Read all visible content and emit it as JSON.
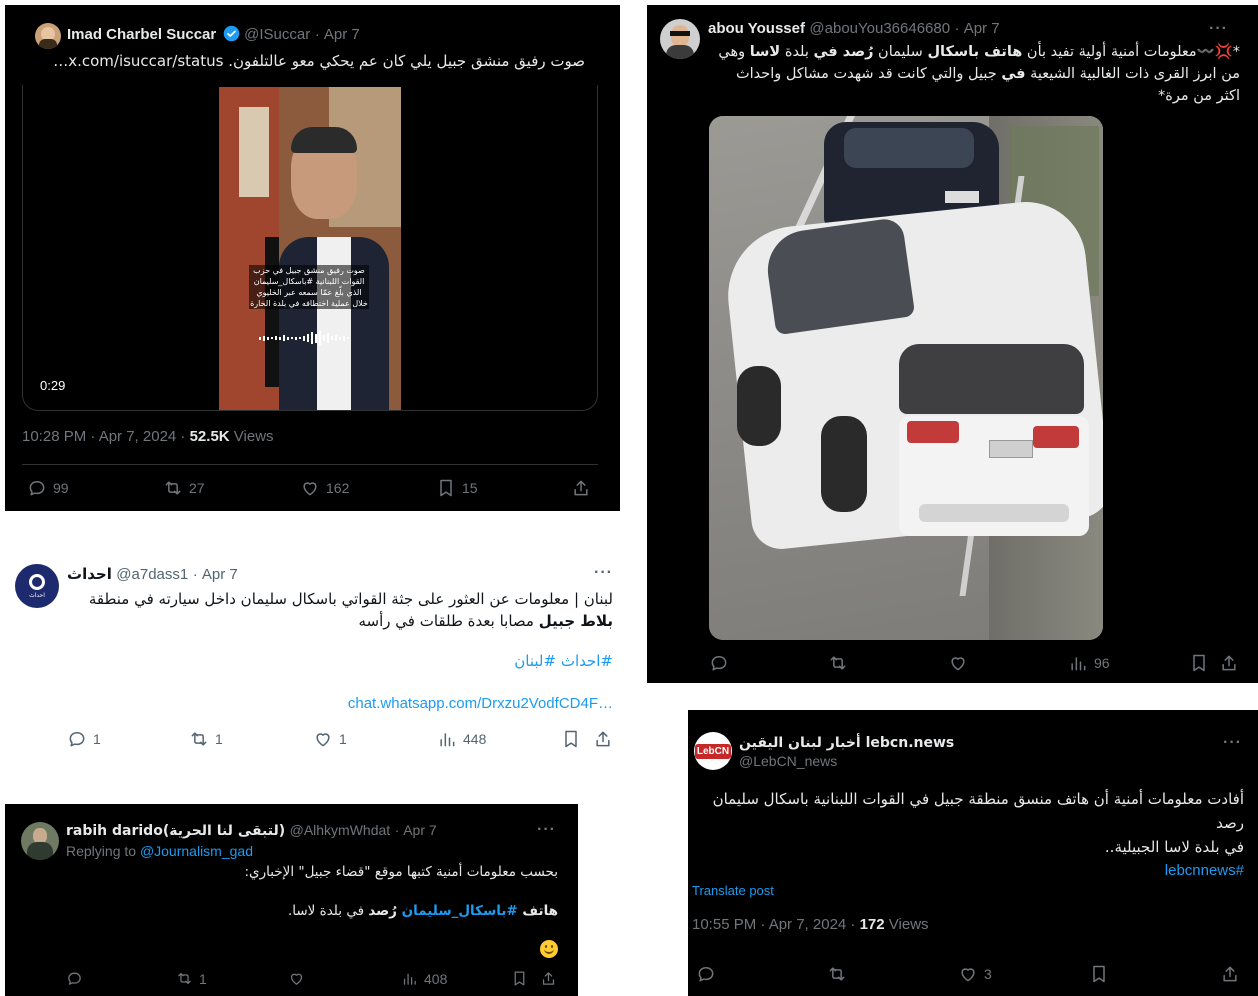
{
  "tweet1": {
    "author": "Imad Charbel Succar",
    "handle": "@ISuccar",
    "date": "Apr 7",
    "text": "صوت رفيق منشق جبيل يلي كان عم يحكي معو عالتلفون.",
    "link": "x.com/isuccar/status…",
    "video_caption": "صوت رفيق منشق جبيل في حزب القوات اللبنانية #باسكال_سليمان الذي بلّغ عمّا سمعه عبر الخليوي خلال عملية اختطافه في بلدة الخارة",
    "duration": "0:29",
    "timestamp": "10:28 PM · Apr 7, 2024 · ",
    "views_count": "52.5K",
    "views_label": " Views",
    "replies": "99",
    "reposts": "27",
    "likes": "162",
    "bookmarks": "15"
  },
  "tweet2": {
    "author": "abou Youssef",
    "handle": "@abouYou36646680",
    "date": "Apr 7",
    "text_part1": "*💢〰️معلومات أمنية أولية تفيد بأن ",
    "text_bold1": "هاتف باسكال",
    "text_part2": " سليمان ",
    "text_bold2": "رُصد في",
    "text_part3": " بلدة ",
    "text_bold3": "لاسا",
    "text_part4": " وهي من ابرز القرى ذات الغالبية الشيعية ",
    "text_bold4": "في",
    "text_part5": " جبيل والتي كانت قد شهدت مشاكل واحداث اكثر من مرة*",
    "views": "96",
    "accent_car": "#f2f2f2"
  },
  "tweet3": {
    "author": "احداث",
    "handle": "@a7dass1",
    "date": "Apr 7",
    "text_part1": "لبنان | معلومات عن العثور على جثة القواتي باسكال سليمان داخل سيارته في منطقة ",
    "text_bold": "بلاط جبيل",
    "text_part2": " مصابا بعدة طلقات في رأسه",
    "hashtags": "#احداث #لبنان",
    "link": "chat.whatsapp.com/Drxzu2VodfCD4F…",
    "avatar_text": "احداث",
    "replies": "1",
    "reposts": "1",
    "likes": "1",
    "views": "448"
  },
  "tweet4": {
    "author": "rabih darido(لتبقى لنا الحرية)",
    "handle": "@AlhkymWhdat",
    "date": "Apr 7",
    "replying_label": "Replying to ",
    "replying_handle": "@Journalism_gad",
    "line1": "بحسب معلومات أمنية كتبها موقع \"قضاء جبيل\" الإخباري:",
    "line2_bold1": "هاتف ",
    "line2_tag": "#باسكال_سليمان",
    "line2_bold2": " رُصد",
    "line2_rest": " في بلدة لاسا.",
    "emoji": "🙂",
    "reposts": "1",
    "views": "408"
  },
  "tweet5": {
    "author": "أخبار لبنان اليقين lebcn.news",
    "handle": "@LebCN_news",
    "avatar_text": "LebCN",
    "line1": "أفادت معلومات أمنية أن هاتف منسق منطقة جبيل في القوات اللبنانية باسكال سليمان رصد",
    "line2": "في بلدة لاسا الجبيلية..",
    "hashtag": "#lebcnnews",
    "translate": "Translate post",
    "timestamp": "10:55 PM · Apr 7, 2024 · ",
    "views_count": "172",
    "views_label": " Views",
    "likes": "3"
  }
}
